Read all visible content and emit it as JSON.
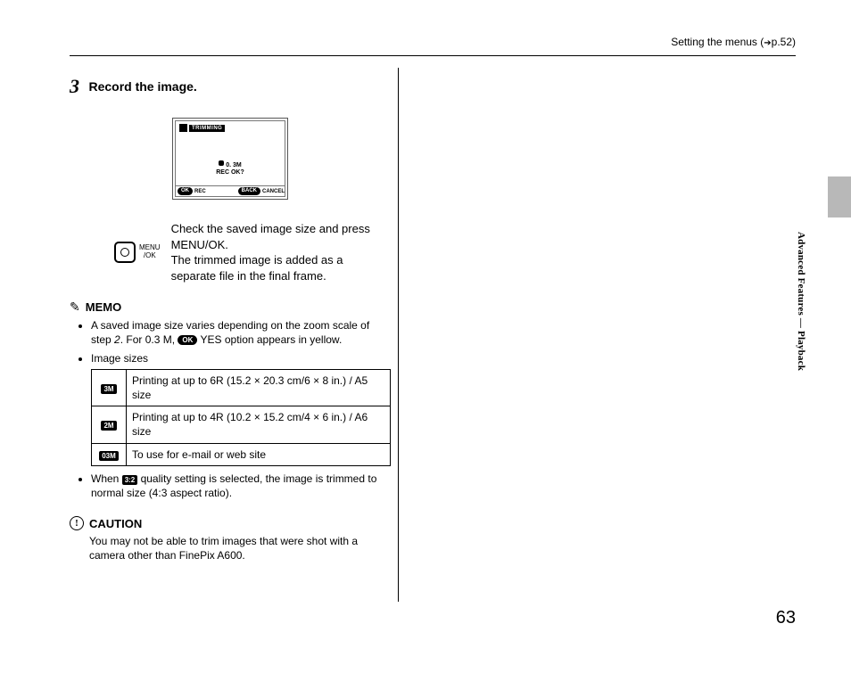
{
  "header": {
    "text": "Setting the menus (",
    "arrow": "➔",
    "page_ref": "p.52)"
  },
  "step": {
    "number": "3",
    "title": "Record the image."
  },
  "lcd": {
    "tag": "TRIMMING",
    "mid_line1": "0. 3M",
    "mid_line2": "REC  OK?",
    "bottom_ok_pill": "OK",
    "bottom_ok_text": "REC",
    "bottom_back_pill": "BACK",
    "bottom_back_text": "CANCEL"
  },
  "menu_ok": {
    "line1": "MENU",
    "line2": "/OK"
  },
  "instruction": {
    "p1": "Check the saved image size and press MENU/OK.",
    "p2": "The trimmed image is added as a separate file in the final frame."
  },
  "memo": {
    "icon": "✎",
    "label": "MEMO",
    "bullet1_a": "A saved image size varies depending on the zoom scale of step ",
    "bullet1_step": "2",
    "bullet1_b": ". For 0.3 M, ",
    "bullet1_pill": "OK",
    "bullet1_c": " YES option appears in yellow.",
    "bullet2": "Image sizes",
    "table": [
      {
        "badge": "3M",
        "text": "Printing at up to 6R (15.2 × 20.3 cm/6 × 8 in.) / A5 size"
      },
      {
        "badge": "2M",
        "text": "Printing at up to 4R (10.2 × 15.2 cm/4 × 6 in.) / A6 size"
      },
      {
        "badge": "03M",
        "text": "To use for e-mail or web site"
      }
    ],
    "bullet3_a": "When ",
    "bullet3_badge": "3:2",
    "bullet3_b": " quality setting is selected, the image is trimmed to normal size (4:3 aspect ratio)."
  },
  "caution": {
    "icon": "!",
    "label": "CAUTION",
    "text": "You may not be able to trim images that were shot with a camera other than FinePix A600."
  },
  "side_section": "Advanced Features — Playback",
  "page_number": "63"
}
